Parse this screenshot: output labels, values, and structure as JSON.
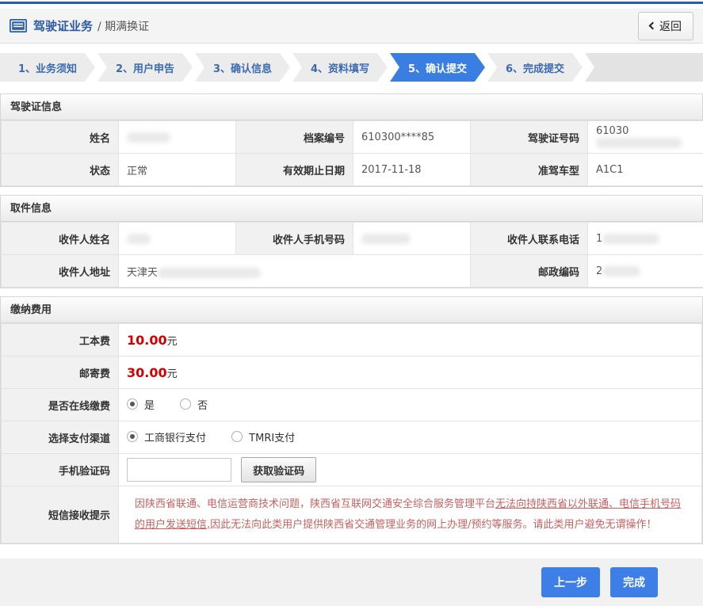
{
  "header": {
    "title": "驾驶证业务",
    "subtitle": "/ 期满换证",
    "back_label": "返回"
  },
  "steps": [
    {
      "label": "1、业务须知",
      "active": false
    },
    {
      "label": "2、用户申告",
      "active": false
    },
    {
      "label": "3、确认信息",
      "active": false
    },
    {
      "label": "4、资料填写",
      "active": false
    },
    {
      "label": "5、确认提交",
      "active": true
    },
    {
      "label": "6、完成提交",
      "active": false
    }
  ],
  "license": {
    "title": "驾驶证信息",
    "name_label": "姓名",
    "name_value": "",
    "file_no_label": "档案编号",
    "file_no_value": "610300****85",
    "license_no_label": "驾驶证号码",
    "license_no_prefix": "61030",
    "status_label": "状态",
    "status_value": "正常",
    "expiry_label": "有效期止日期",
    "expiry_value": "2017-11-18",
    "vehicle_label": "准驾车型",
    "vehicle_value": "A1C1"
  },
  "pickup": {
    "title": "取件信息",
    "recipient_label": "收件人姓名",
    "recipient_value": "",
    "mobile_label": "收件人手机号码",
    "mobile_value": "",
    "contact_label": "收件人联系电话",
    "contact_prefix": "1",
    "address_label": "收件人地址",
    "address_prefix": "天津天",
    "postal_label": "邮政编码",
    "postal_prefix": "2"
  },
  "payment": {
    "title": "缴纳费用",
    "fee_label": "工本费",
    "fee_value": "10.00",
    "fee_unit": "元",
    "postage_label": "邮寄费",
    "postage_value": "30.00",
    "postage_unit": "元",
    "online_label": "是否在线缴费",
    "online_options": [
      "是",
      "否"
    ],
    "online_selected": "是",
    "channel_label": "选择支付渠道",
    "channel_options": [
      "工商银行支付",
      "TMRI支付"
    ],
    "channel_selected": "工商银行支付",
    "code_label": "手机验证码",
    "code_value": "",
    "get_code_label": "获取验证码",
    "notice_label": "短信接收提示",
    "notice_part1": "因陕西省联通、电信运营商技术问题，陕西省互联网交通安全综合服务管理平台",
    "notice_part2": "无法向持陕西省以外联通、电信手机号码的用户发送短信,",
    "notice_part3": "因此无法向此类用户提供陕西省交通管理业务的网上办理/预约等服务。请此类用户避免无谓操作！"
  },
  "footer": {
    "prev_label": "上一步",
    "finish_label": "完成"
  },
  "colors": {
    "accent_blue": "#3b7ee2",
    "fee_red": "#d40000",
    "notice_red": "#c66161",
    "top_bar_blue": "#2a5da8"
  }
}
